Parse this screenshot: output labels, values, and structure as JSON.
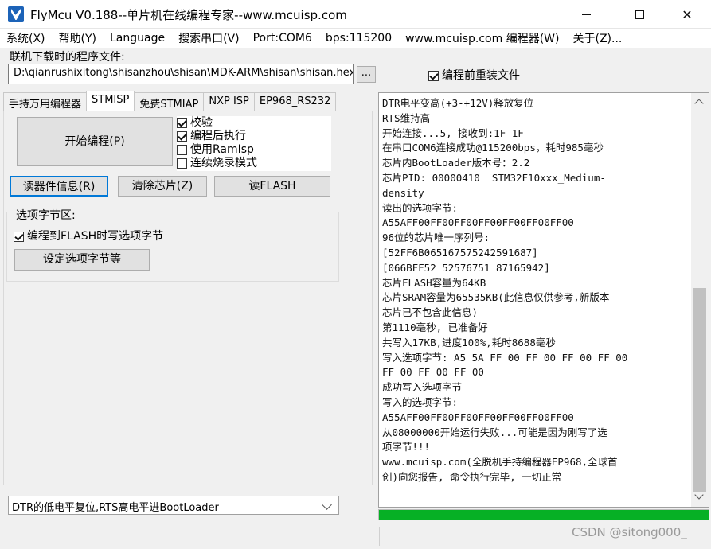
{
  "window": {
    "title": "FlyMcu V0.188--单片机在线编程专家--www.mcuisp.com",
    "minimize": "—",
    "maximize": "□",
    "close": "✕"
  },
  "menu": [
    "系统(X)",
    "帮助(Y)",
    "Language",
    "搜索串口(V)",
    "Port:COM6",
    "bps:115200",
    "www.mcuisp.com 编程器(W)",
    "关于(Z)..."
  ],
  "file": {
    "label": "联机下载时的程序文件:",
    "path": "D:\\qianrushixitong\\shisanzhou\\shisan\\MDK-ARM\\shisan\\shisan.hex",
    "browse_label": "...",
    "reload_label": "编程前重装文件",
    "reload_checked": true
  },
  "tabs": [
    "手持万用编程器",
    "STMISP",
    "免费STMIAP",
    "NXP ISP",
    "EP968_RS232"
  ],
  "active_tab": "STMISP",
  "panel": {
    "start_button": "开始编程(P)",
    "options": [
      {
        "label": "校验",
        "checked": true
      },
      {
        "label": "编程后执行",
        "checked": true
      },
      {
        "label": "使用RamIsp",
        "checked": false
      },
      {
        "label": "连续烧录模式",
        "checked": false
      }
    ],
    "read_info_button": "读器件信息(R)",
    "clear_chip_button": "清除芯片(Z)",
    "read_flash_button": "读FLASH",
    "option_group_title": "选项字节区:",
    "write_option_label": "编程到FLASH时写选项字节",
    "write_option_checked": true,
    "set_option_button": "设定选项字节等"
  },
  "reset_mode": "DTR的低电平复位,RTS高电平进BootLoader",
  "log": [
    "DTR电平变高(+3-+12V)释放复位",
    "RTS维持高",
    "开始连接...5, 接收到:1F 1F",
    "在串口COM6连接成功@115200bps，耗时985毫秒",
    "芯片内BootLoader版本号：2.2",
    "芯片PID: 00000410  STM32F10xxx_Medium-",
    "density",
    "读出的选项字节:",
    "A55AFF00FF00FF00FF00FF00FF00FF00",
    "96位的芯片唯一序列号:",
    "[52FF6B065167575242591687]",
    "[066BFF52 52576751 87165942]",
    "芯片FLASH容量为64KB",
    "芯片SRAM容量为65535KB(此信息仅供参考,新版本",
    "芯片已不包含此信息)",
    "第1110毫秒, 已准备好",
    "共写入17KB,进度100%,耗时8688毫秒",
    "写入选项字节: A5 5A FF 00 FF 00 FF 00 FF 00",
    "FF 00 FF 00 FF 00",
    "成功写入选项字节",
    "写入的选项字节:",
    "A55AFF00FF00FF00FF00FF00FF00FF00",
    "从08000000开始运行失败...可能是因为刚写了选",
    "项字节!!!",
    "www.mcuisp.com(全脱机手持编程器EP968,全球首",
    "创)向您报告, 命令执行完毕, 一切正常"
  ],
  "progress_percent": 100,
  "watermark": "CSDN @sitong000_",
  "colors": {
    "progress": "#06b025",
    "focus_border": "#0078d7",
    "app_icon": "#1c63b8"
  }
}
